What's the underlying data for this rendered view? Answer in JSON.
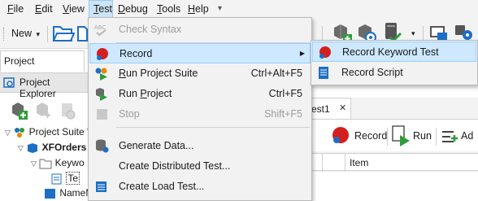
{
  "menubar": {
    "items": [
      {
        "label": "File",
        "mnemonic": "F",
        "rest": "ile"
      },
      {
        "label": "Edit",
        "mnemonic": "E",
        "rest": "dit"
      },
      {
        "label": "View",
        "mnemonic": "V",
        "rest": "iew"
      },
      {
        "label": "Test",
        "mnemonic": "T",
        "rest": "est"
      },
      {
        "label": "Debug",
        "mnemonic": "D",
        "rest": "ebug"
      },
      {
        "label": "Tools",
        "mnemonic": "T",
        "rest": "ools"
      },
      {
        "label": "Help",
        "mnemonic": "H",
        "rest": "elp"
      }
    ],
    "overflow_glyph": "▾"
  },
  "toolbar": {
    "new_label": "New",
    "dropdown_glyph": "▾"
  },
  "left_panel": {
    "workspace_tab": "Project Workspace",
    "explorer_tab": "Project Explorer",
    "tree": {
      "suite": "Project Suite 'X",
      "project": "XFOrders",
      "keyword": "Keywo",
      "test_item": "Te",
      "name_mapping": "NameMapping"
    }
  },
  "right_area": {
    "tab_label": "est1",
    "tab_close": "✕",
    "record_button": "Record",
    "run_button": "Run",
    "add_button": "Ad",
    "column_item": "Item"
  },
  "test_menu": {
    "items": [
      {
        "label": "Check Syntax",
        "shortcut": "",
        "enabled": false
      },
      {
        "label": "Record",
        "shortcut": "",
        "enabled": true,
        "submenu": true
      },
      {
        "label": "Run Project Suite",
        "shortcut": "Ctrl+Alt+F5",
        "enabled": true
      },
      {
        "label": "Run Project",
        "shortcut": "Ctrl+F5",
        "enabled": true
      },
      {
        "label": "Stop",
        "shortcut": "Shift+F5",
        "enabled": false
      },
      {
        "label": "Generate Data...",
        "shortcut": "",
        "enabled": true
      },
      {
        "label": "Create Distributed Test...",
        "shortcut": "",
        "enabled": true
      },
      {
        "label": "Create Load Test...",
        "shortcut": "",
        "enabled": true
      }
    ],
    "submenu_arrow": "▶"
  },
  "record_submenu": {
    "items": [
      {
        "label": "Record Keyword Test"
      },
      {
        "label": "Record Script"
      }
    ]
  }
}
